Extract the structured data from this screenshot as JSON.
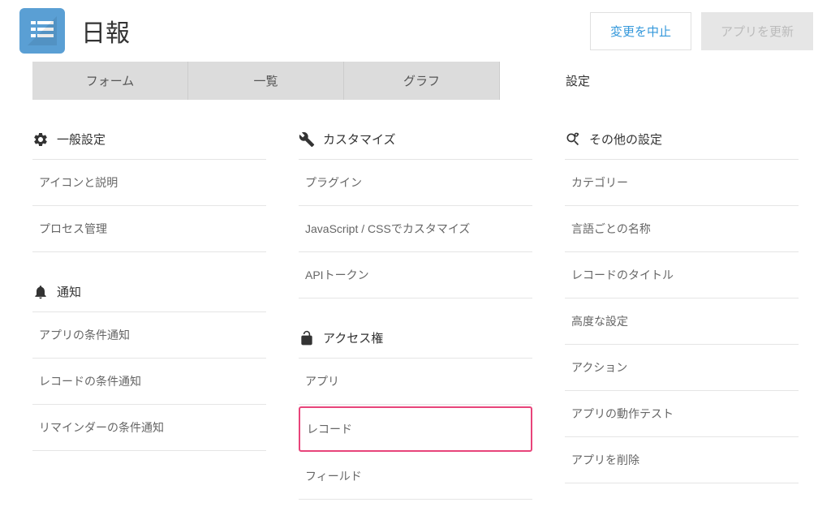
{
  "header": {
    "title": "日報",
    "cancel_label": "変更を中止",
    "update_label": "アプリを更新"
  },
  "tabs": [
    {
      "label": "フォーム",
      "active": false
    },
    {
      "label": "一覧",
      "active": false
    },
    {
      "label": "グラフ",
      "active": false
    },
    {
      "label": "設定",
      "active": true
    }
  ],
  "columns": [
    {
      "sections": [
        {
          "icon": "gear",
          "title": "一般設定",
          "items": [
            {
              "label": "アイコンと説明"
            },
            {
              "label": "プロセス管理"
            }
          ]
        },
        {
          "icon": "bell",
          "title": "通知",
          "items": [
            {
              "label": "アプリの条件通知"
            },
            {
              "label": "レコードの条件通知"
            },
            {
              "label": "リマインダーの条件通知"
            }
          ]
        }
      ]
    },
    {
      "sections": [
        {
          "icon": "wrench",
          "title": "カスタマイズ",
          "items": [
            {
              "label": "プラグイン"
            },
            {
              "label": "JavaScript / CSSでカスタマイズ"
            },
            {
              "label": "APIトークン"
            }
          ]
        },
        {
          "icon": "lock",
          "title": "アクセス権",
          "items": [
            {
              "label": "アプリ"
            },
            {
              "label": "レコード",
              "highlighted": true
            },
            {
              "label": "フィールド"
            }
          ]
        }
      ]
    },
    {
      "sections": [
        {
          "icon": "misc",
          "title": "その他の設定",
          "items": [
            {
              "label": "カテゴリー"
            },
            {
              "label": "言語ごとの名称"
            },
            {
              "label": "レコードのタイトル"
            },
            {
              "label": "高度な設定"
            },
            {
              "label": "アクション"
            },
            {
              "label": "アプリの動作テスト"
            },
            {
              "label": "アプリを削除"
            }
          ]
        }
      ]
    }
  ]
}
